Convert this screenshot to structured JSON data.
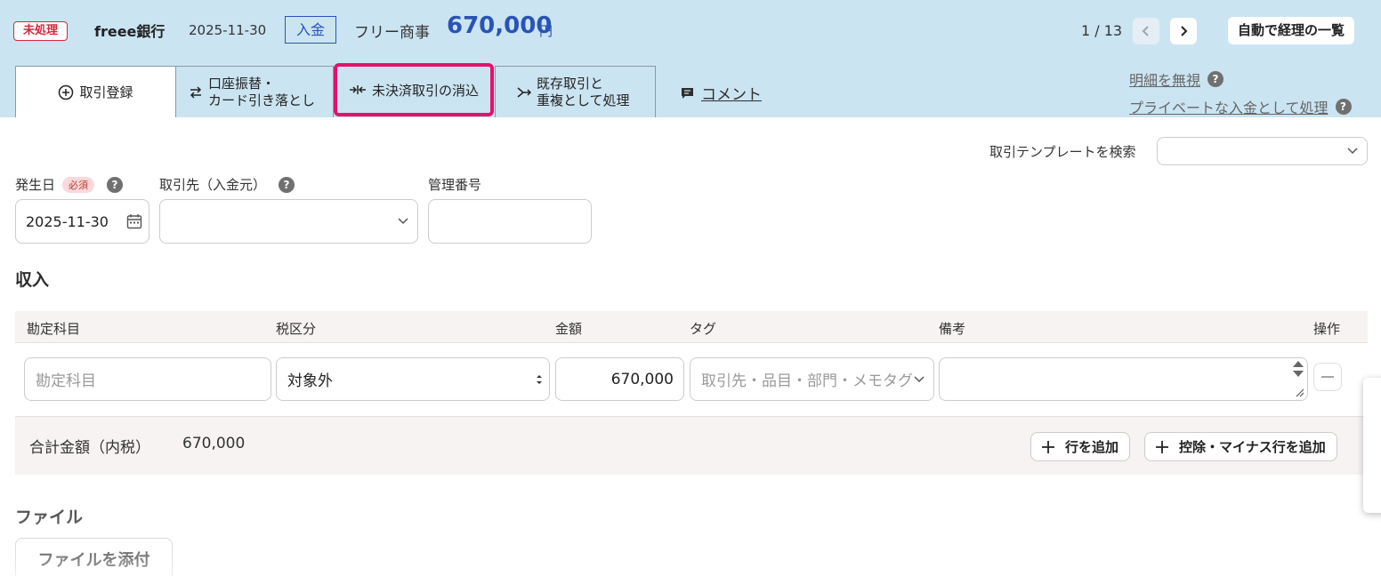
{
  "header": {
    "status": "未処理",
    "bank": "freee銀行",
    "date": "2025-11-30",
    "type": "入金",
    "partner": "フリー商事",
    "amount": "670,000",
    "currency": "円",
    "pager": "1 / 13",
    "auto_button": "自動で経理の一覧"
  },
  "tabs": {
    "register": "取引登録",
    "transfer_line1": "口座振替・",
    "transfer_line2": "カード引き落とし",
    "clear": "未決済取引の消込",
    "dup_line1": "既存取引と",
    "dup_line2": "重複として処理",
    "comment": "コメント"
  },
  "links": {
    "ignore": "明細を無視",
    "private": "プライベートな入金として処理"
  },
  "form": {
    "template_label": "取引テンプレートを検索",
    "date_label": "発生日",
    "required": "必須",
    "date_value": "2025-11-30",
    "partner_label": "取引先（入金元）",
    "mgmt_label": "管理番号"
  },
  "income": {
    "title": "収入",
    "headers": [
      "勘定科目",
      "税区分",
      "金額",
      "タグ",
      "備考",
      "操作"
    ],
    "row": {
      "account_placeholder": "勘定科目",
      "tax": "対象外",
      "amount": "670,000",
      "tag_placeholder": "取引先・品目・部門・メモタグ"
    },
    "total_label": "合計金額（内税）",
    "total_value": "670,000",
    "add_row": "行を追加",
    "add_minus_row": "控除・マイナス行を追加"
  },
  "file": {
    "title": "ファイル",
    "attach_button": "ファイルを添付"
  }
}
